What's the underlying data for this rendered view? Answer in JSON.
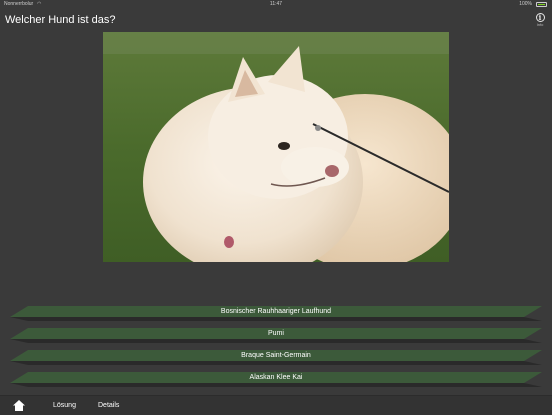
{
  "status": {
    "carrier": "Nonnerrbolur",
    "time": "11:47",
    "battery": "100%",
    "battery_level": 1.0
  },
  "header": {
    "title": "Welcher Hund ist das?",
    "info_label": "Info"
  },
  "photo": {
    "icon": "dog-photo"
  },
  "answers": [
    "Bosnischer Rauhhaariger Laufhund",
    "Pumi",
    "Braque Saint-Germain",
    "Alaskan Klee Kai"
  ],
  "toolbar": {
    "home_icon": "home-icon",
    "solution_label": "Lösung",
    "details_label": "Details"
  },
  "colors": {
    "background": "#3a3a3a",
    "answer_green": "#3c5a3a",
    "answer_shadow": "#2a2a2a"
  }
}
